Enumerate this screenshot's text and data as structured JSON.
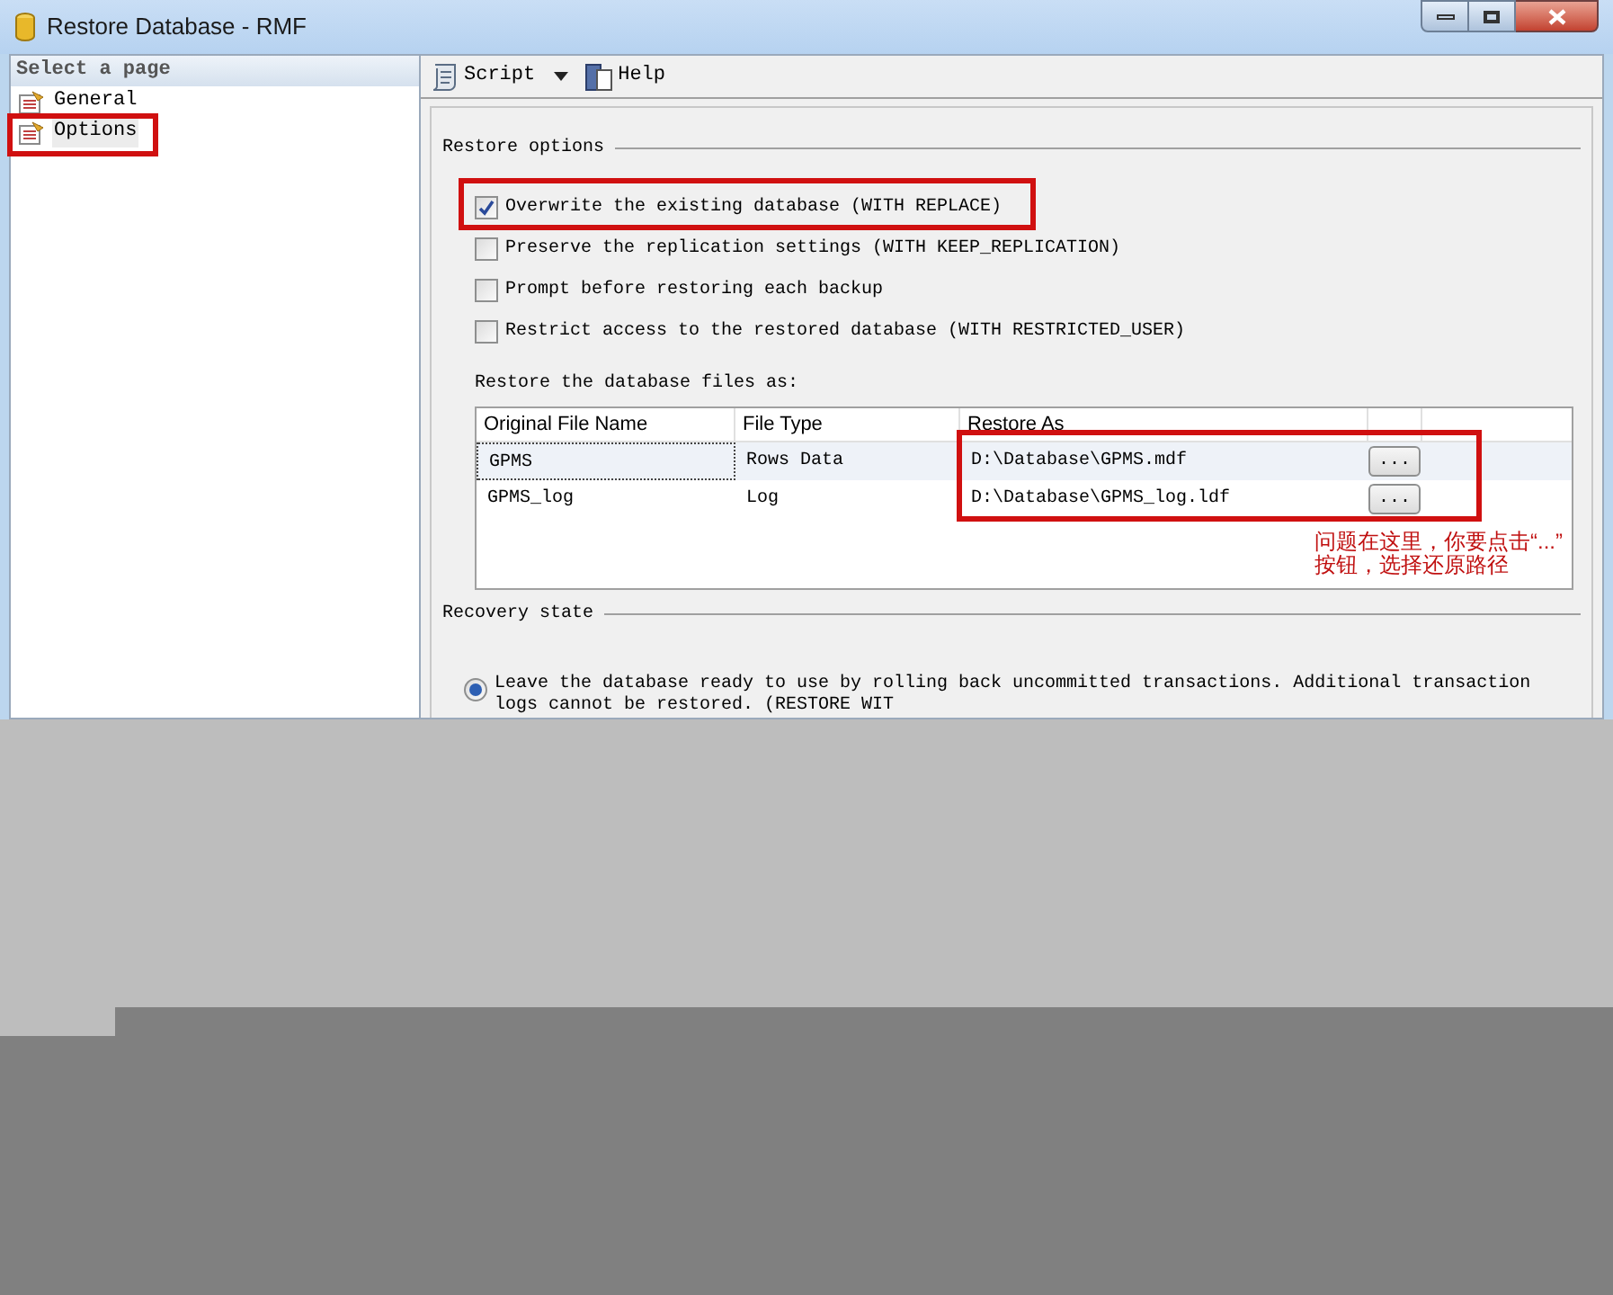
{
  "window": {
    "title": "Restore Database - RMF"
  },
  "sidebar": {
    "header": "Select a page",
    "items": [
      {
        "label": "General",
        "selected": false,
        "highlighted": false
      },
      {
        "label": "Options",
        "selected": true,
        "highlighted": true
      }
    ]
  },
  "toolbar": [
    {
      "kind": "script",
      "label": "Script"
    },
    {
      "kind": "help",
      "label": "Help"
    }
  ],
  "restore_options": {
    "title": "Restore options",
    "checkboxes": [
      {
        "label": "Overwrite the existing database (WITH REPLACE)",
        "checked": true,
        "highlighted": true
      },
      {
        "label": "Preserve the replication settings (WITH KEEP_REPLICATION)",
        "checked": false,
        "highlighted": false
      },
      {
        "label": "Prompt before restoring each backup",
        "checked": false,
        "highlighted": false
      },
      {
        "label": "Restrict access to the restored database (WITH RESTRICTED_USER)",
        "checked": false,
        "highlighted": false
      }
    ]
  },
  "files": {
    "label": "Restore the database files as:",
    "highlighted": true,
    "columns": [
      "Original File Name",
      "File Type",
      "Restore As"
    ],
    "rows": [
      {
        "cells": [
          "GPMS",
          "Rows Data",
          "D:\\Database\\GPMS.mdf"
        ],
        "button": "...",
        "selected": true
      },
      {
        "cells": [
          "GPMS_log",
          "Log",
          "D:\\Database\\GPMS_log.ldf"
        ],
        "button": "...",
        "selected": false
      }
    ]
  },
  "annotation": {
    "line_1": "问题在这里，你要点击“...”",
    "line_2": "按钮，选择还原路径"
  },
  "recovery": {
    "title": "Recovery state",
    "options": [
      {
        "line_1": "Leave the database ready to use by rolling back uncommitted transactions. Additional transaction",
        "line_2": "logs cannot be restored. (RESTORE WIT",
        "selected": true
      }
    ]
  }
}
